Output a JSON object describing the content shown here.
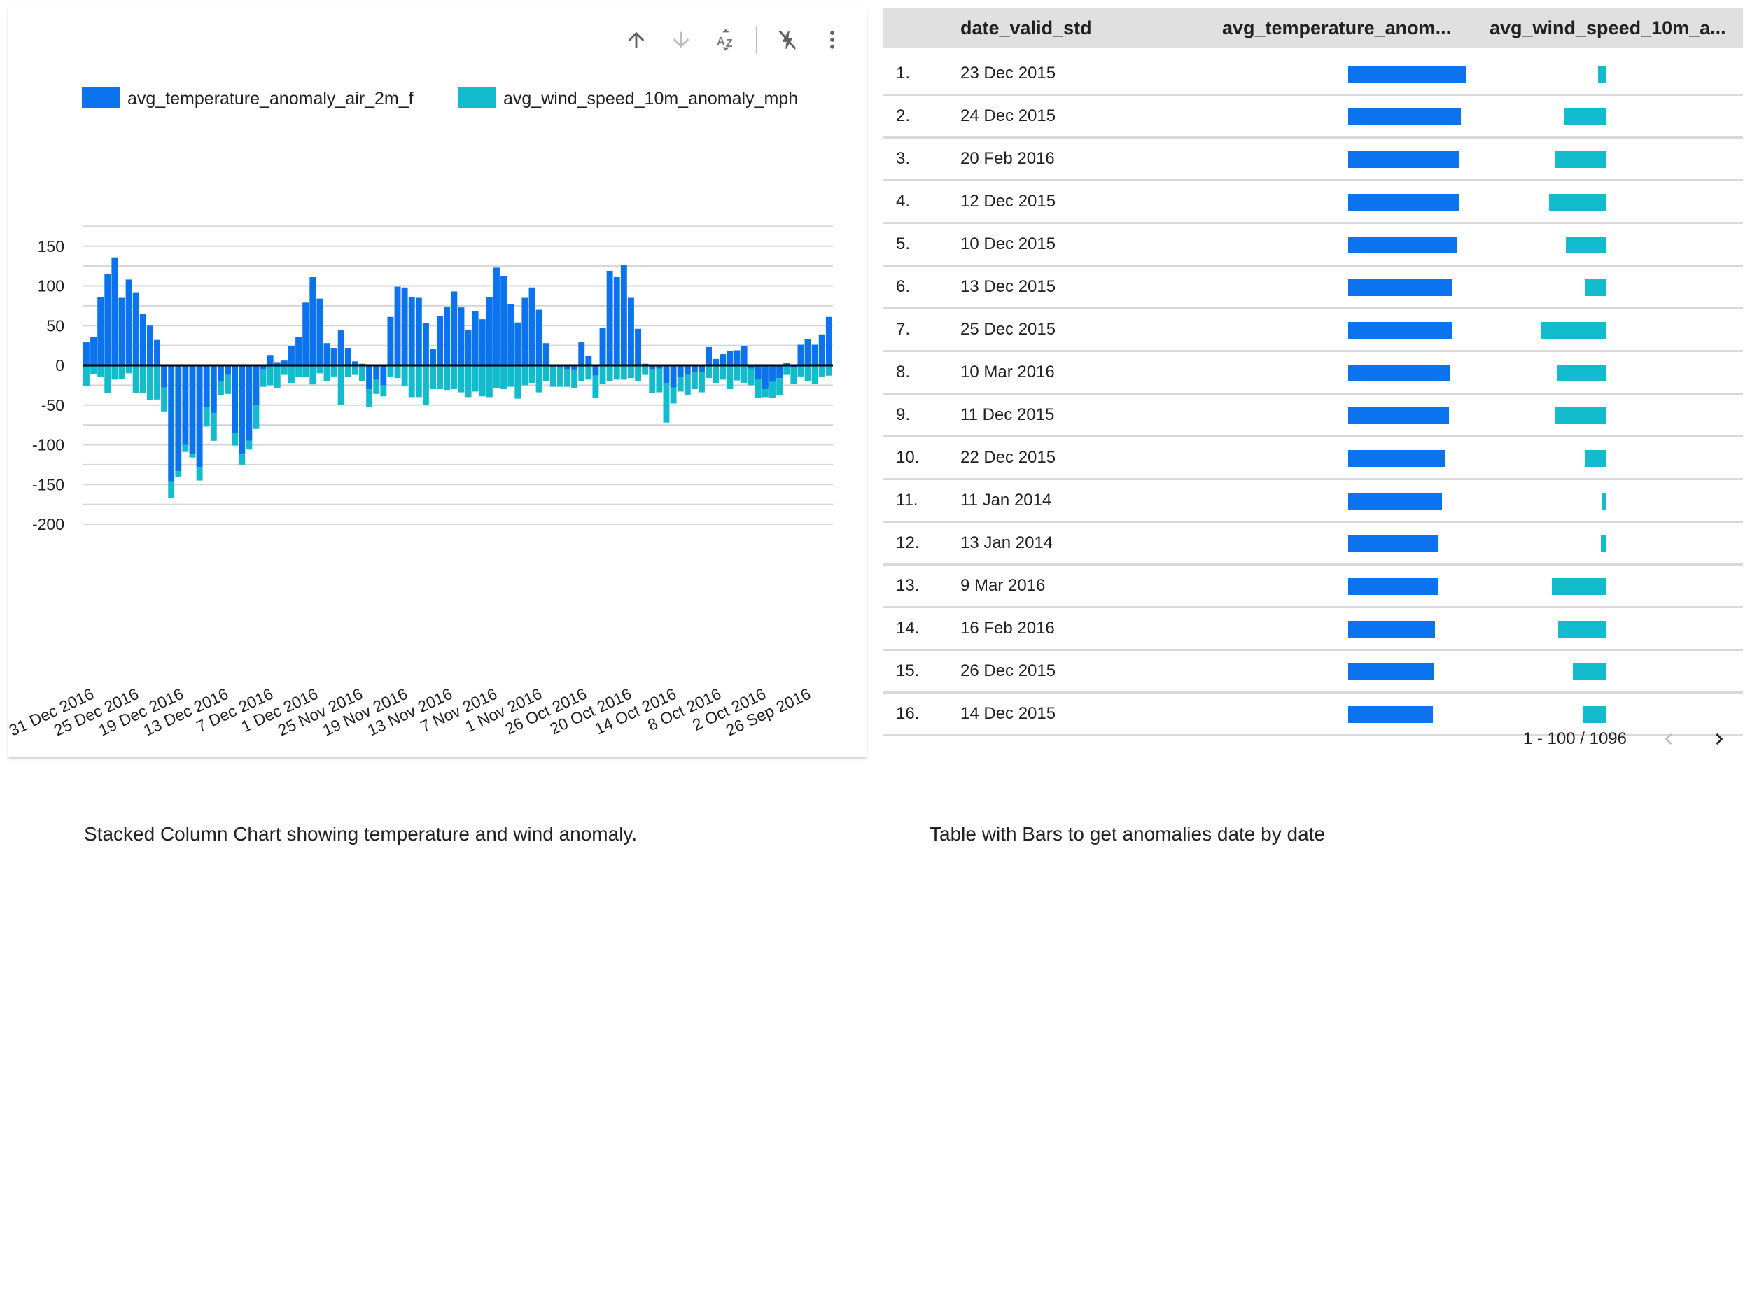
{
  "toolbar": {
    "icons": [
      "sort-ascending-icon",
      "sort-descending-icon",
      "sort-alphabetical-icon",
      "drill-action-icon",
      "more-vert-icon"
    ]
  },
  "colors": {
    "temperature": "#0b73ee",
    "wind": "#12bccc",
    "grid": "#d6d6d6",
    "zero_line": "#000000"
  },
  "chart_data": {
    "type": "bar",
    "stacked": true,
    "title": "",
    "xlabel": "",
    "ylabel": "",
    "ylim": [
      -200,
      150
    ],
    "yticks": [
      150,
      100,
      50,
      0,
      -50,
      -100,
      -150,
      -200
    ],
    "grid": true,
    "legend_position": "top",
    "x_tick_labels": [
      "31 Dec 2016",
      "25 Dec 2016",
      "19 Dec 2016",
      "13 Dec 2016",
      "7 Dec 2016",
      "1 Dec 2016",
      "25 Nov 2016",
      "19 Nov 2016",
      "13 Nov 2016",
      "7 Nov 2016",
      "1 Nov 2016",
      "26 Oct 2016",
      "20 Oct 2016",
      "14 Oct 2016",
      "8 Oct 2016",
      "2 Oct 2016",
      "26 Sep 2016"
    ],
    "series": [
      {
        "name": "avg_temperature_anomaly_air_2m_f",
        "values": [
          29,
          36,
          86,
          115,
          136,
          85,
          108,
          92,
          65,
          50,
          32,
          -28,
          -146,
          -133,
          -100,
          -112,
          -128,
          -52,
          -60,
          -20,
          -12,
          -85,
          -112,
          -95,
          -50,
          -5,
          13,
          4,
          6,
          24,
          36,
          79,
          111,
          84,
          28,
          22,
          44,
          22,
          5,
          2,
          -30,
          -18,
          -25,
          61,
          99,
          98,
          86,
          85,
          53,
          21,
          62,
          74,
          93,
          73,
          45,
          68,
          58,
          86,
          123,
          112,
          77,
          54,
          85,
          98,
          70,
          28,
          -2,
          -3,
          -5,
          -6,
          29,
          12,
          -13,
          47,
          119,
          111,
          126,
          85,
          46,
          2,
          -5,
          -4,
          -22,
          -28,
          -15,
          -12,
          -8,
          -8,
          23,
          8,
          14,
          18,
          19,
          24,
          -4,
          -18,
          -30,
          -21,
          -16,
          3,
          -3,
          26,
          33,
          26,
          39,
          61
        ],
        "color": "#0b73ee"
      },
      {
        "name": "avg_wind_speed_10m_anomaly_mph",
        "values": [
          -26,
          -11,
          -15,
          -35,
          -18,
          -17,
          -10,
          -35,
          -35,
          -44,
          -43,
          -30,
          -21,
          -7,
          -9,
          -4,
          -17,
          -25,
          -35,
          -17,
          -24,
          -16,
          -13,
          -11,
          -30,
          -22,
          -25,
          -29,
          -12,
          -22,
          -15,
          -15,
          -24,
          -10,
          -20,
          -14,
          -50,
          -15,
          -12,
          -20,
          -22,
          -18,
          -14,
          -15,
          -16,
          -26,
          -40,
          -40,
          -50,
          -30,
          -30,
          -31,
          -30,
          -34,
          -40,
          -33,
          -39,
          -40,
          -29,
          -30,
          -27,
          -42,
          -25,
          -22,
          -34,
          -20,
          -25,
          -24,
          -22,
          -23,
          -20,
          -18,
          -28,
          -23,
          -20,
          -18,
          -18,
          -16,
          -20,
          -12,
          -30,
          -30,
          -50,
          -20,
          -18,
          -25,
          -22,
          -26,
          -16,
          -22,
          -18,
          -30,
          -19,
          -22,
          -21,
          -23,
          -10,
          -20,
          -22,
          -12,
          -20,
          -14,
          -20,
          -23,
          -15,
          -13
        ]
      }
    ]
  },
  "table": {
    "columns": {
      "date": "date_valid_std",
      "temp": "avg_temperature_anom...",
      "wind": "avg_wind_speed_10m_a..."
    },
    "rows": [
      {
        "idx": "1.",
        "date": "23 Dec 2015",
        "temp": 100,
        "wind": 7
      },
      {
        "idx": "2.",
        "date": "24 Dec 2015",
        "temp": 96,
        "wind": 37
      },
      {
        "idx": "3.",
        "date": "20 Feb 2016",
        "temp": 94,
        "wind": 44
      },
      {
        "idx": "4.",
        "date": "12 Dec 2015",
        "temp": 94,
        "wind": 50
      },
      {
        "idx": "5.",
        "date": "10 Dec 2015",
        "temp": 93,
        "wind": 35
      },
      {
        "idx": "6.",
        "date": "13 Dec 2015",
        "temp": 88,
        "wind": 19
      },
      {
        "idx": "7.",
        "date": "25 Dec 2015",
        "temp": 88,
        "wind": 57
      },
      {
        "idx": "8.",
        "date": "10 Mar 2016",
        "temp": 87,
        "wind": 43
      },
      {
        "idx": "9.",
        "date": "11 Dec 2015",
        "temp": 86,
        "wind": 44
      },
      {
        "idx": "10.",
        "date": "22 Dec 2015",
        "temp": 83,
        "wind": 19
      },
      {
        "idx": "11.",
        "date": "11 Jan 2014",
        "temp": 80,
        "wind": 4
      },
      {
        "idx": "12.",
        "date": "13 Jan 2014",
        "temp": 76,
        "wind": 5
      },
      {
        "idx": "13.",
        "date": "9 Mar 2016",
        "temp": 76,
        "wind": 47
      },
      {
        "idx": "14.",
        "date": "16 Feb 2016",
        "temp": 74,
        "wind": 42
      },
      {
        "idx": "15.",
        "date": "26 Dec 2015",
        "temp": 73,
        "wind": 29
      },
      {
        "idx": "16.",
        "date": "14 Dec 2015",
        "temp": 72,
        "wind": 20
      }
    ]
  },
  "pagination": {
    "range_text": "1 - 100 / 1096",
    "prev_icon": "chevron-left-icon",
    "next_icon": "chevron-right-icon"
  },
  "captions": {
    "chart": "Stacked Column Chart showing temperature and wind anomaly.",
    "table": "Table with Bars to get anomalies date by date"
  }
}
